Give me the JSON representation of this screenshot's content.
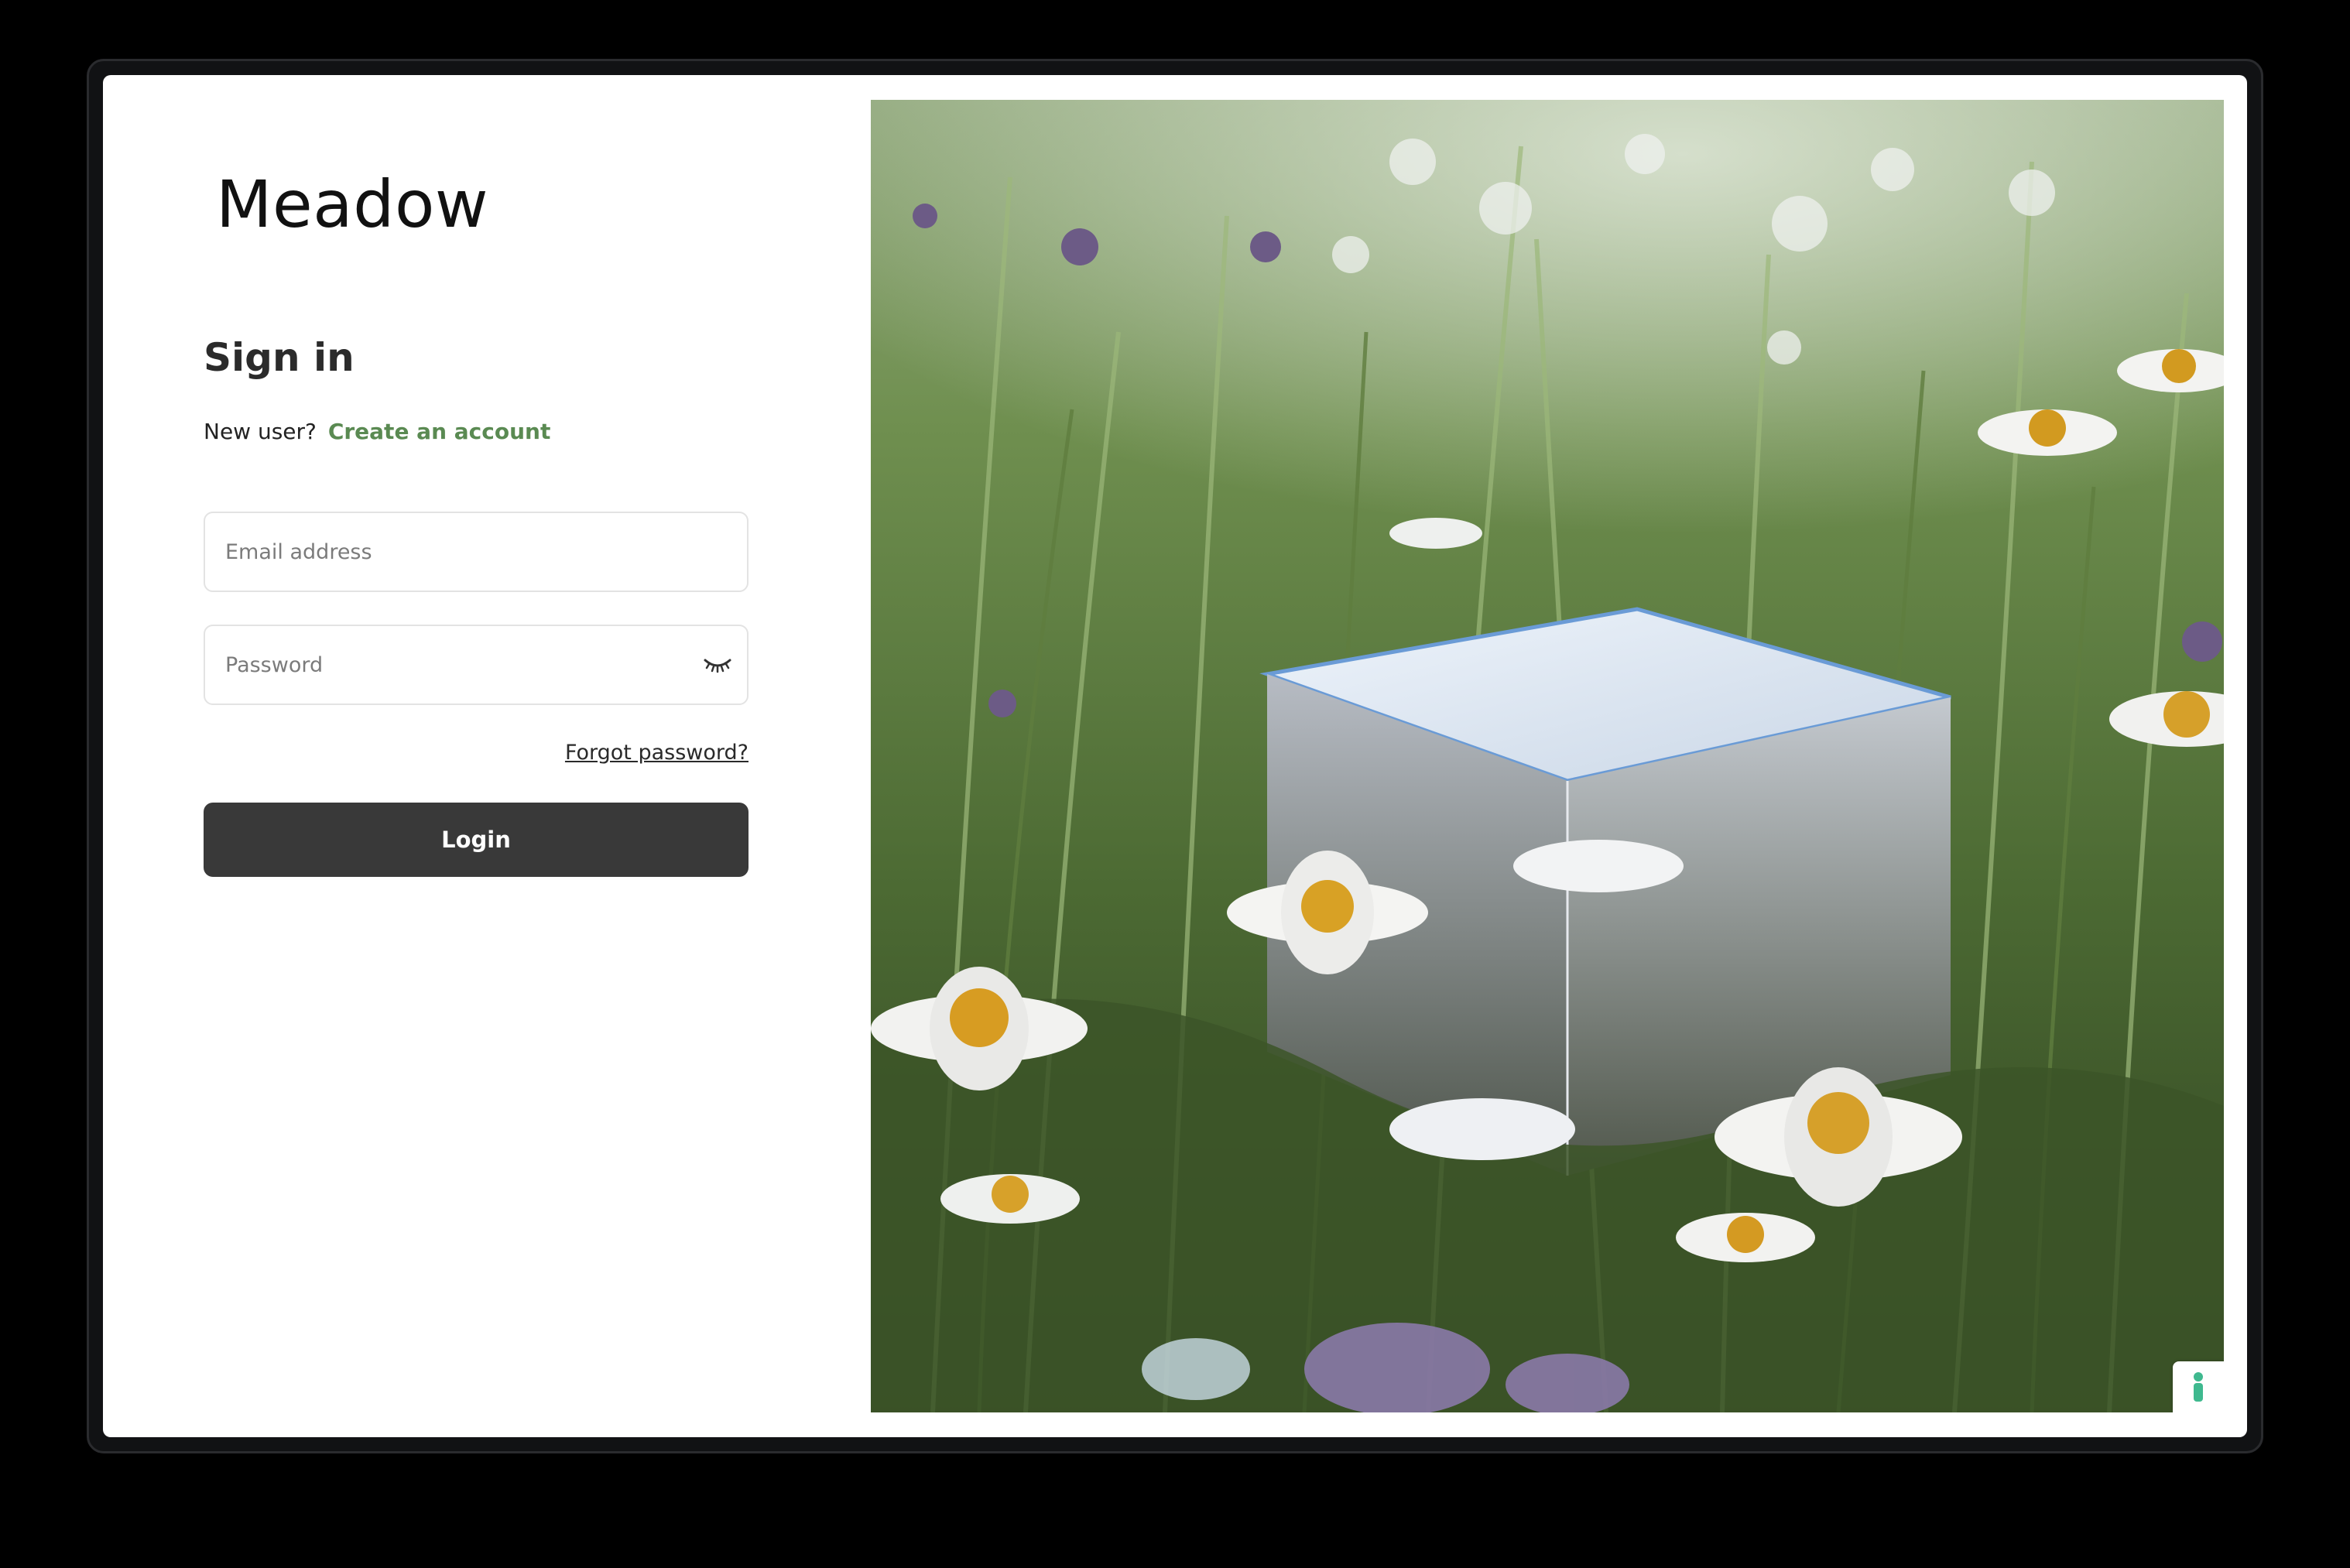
{
  "brand": {
    "name": "Meadow"
  },
  "signin": {
    "heading": "Sign in",
    "new_user_text": "New user?",
    "create_account_link": "Create an account",
    "email_placeholder": "Email address",
    "password_placeholder": "Password",
    "forgot_password_link": "Forgot password?",
    "login_button": "Login"
  },
  "icons": {
    "password_toggle": "eye-closed-icon",
    "feedback": "figure-icon"
  },
  "colors": {
    "accent_link": "#5a8a52",
    "button_bg": "#393939",
    "feedback_icon": "#3fb98f"
  }
}
